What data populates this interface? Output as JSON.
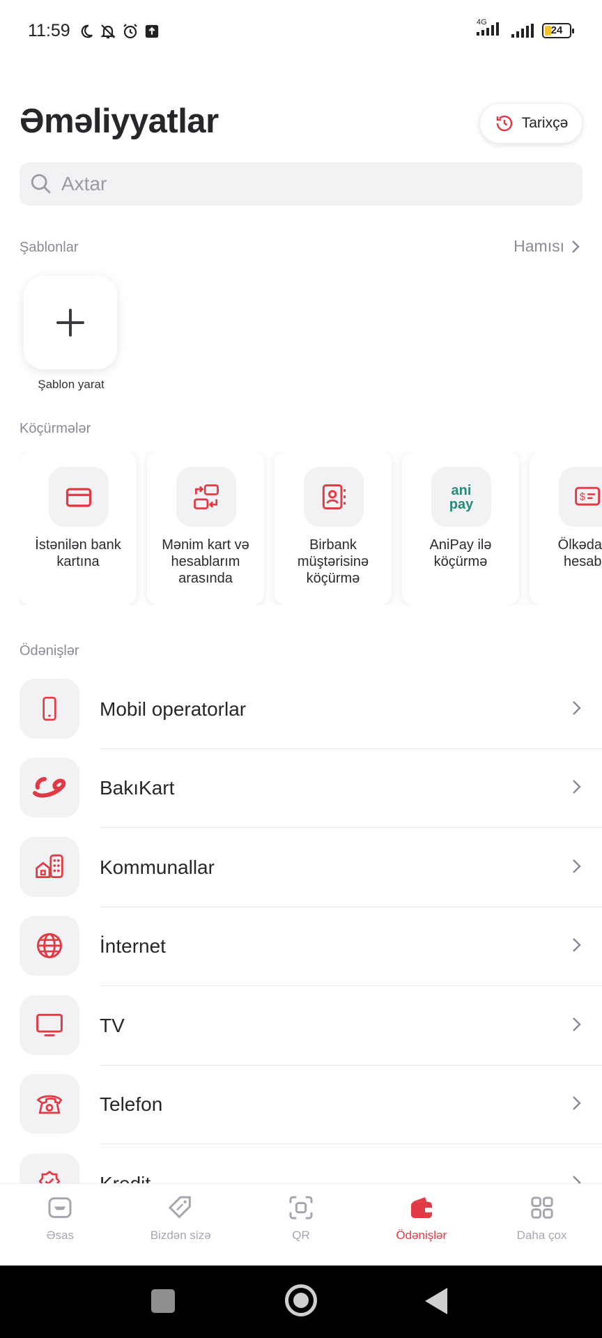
{
  "status_bar": {
    "time": "11:59",
    "network": "4G",
    "battery": "24"
  },
  "header": {
    "title": "Əməliyyatlar",
    "history_label": "Tarixçə"
  },
  "search": {
    "placeholder": "Axtar"
  },
  "templates": {
    "section_label": "Şablonlar",
    "see_all_label": "Hamısı",
    "create_label": "Şablon yarat"
  },
  "transfers": {
    "section_label": "Köçürmələr",
    "items": [
      {
        "label": "İstənilən bank kartına",
        "icon": "card-icon"
      },
      {
        "label": "Mənim kart və hesablarım arasında",
        "icon": "transfer-between-icon"
      },
      {
        "label": "Birbank müştərisinə köçürmə",
        "icon": "contact-book-icon"
      },
      {
        "label": "AniPay ilə köçürmə",
        "icon": "anipay-logo"
      },
      {
        "label": "Ölkədaxili hesabla",
        "icon": "invoice-icon"
      }
    ],
    "anipay_logo_text": "ani pay"
  },
  "payments": {
    "section_label": "Ödənişlər",
    "items": [
      {
        "label": "Mobil operatorlar",
        "icon": "mobile-phone-icon"
      },
      {
        "label": "BakıKart",
        "icon": "bakikart-logo"
      },
      {
        "label": "Kommunallar",
        "icon": "utilities-icon"
      },
      {
        "label": "İnternet",
        "icon": "globe-icon"
      },
      {
        "label": "TV",
        "icon": "tv-icon"
      },
      {
        "label": "Telefon",
        "icon": "telephone-icon"
      },
      {
        "label": "Kredit",
        "icon": "credit-icon"
      }
    ]
  },
  "bottom_nav": {
    "items": [
      {
        "label": "Əsas",
        "icon": "home-card-icon",
        "active": false
      },
      {
        "label": "Bizdən sizə",
        "icon": "tag-icon",
        "active": false
      },
      {
        "label": "QR",
        "icon": "qr-scan-icon",
        "active": false
      },
      {
        "label": "Ödənişlər",
        "icon": "wallet-icon",
        "active": true
      },
      {
        "label": "Daha çox",
        "icon": "grid-icon",
        "active": false
      }
    ]
  },
  "colors": {
    "accent": "#e03a45",
    "icon_bg": "#f2f2f5",
    "muted_text": "#8a8a98"
  }
}
